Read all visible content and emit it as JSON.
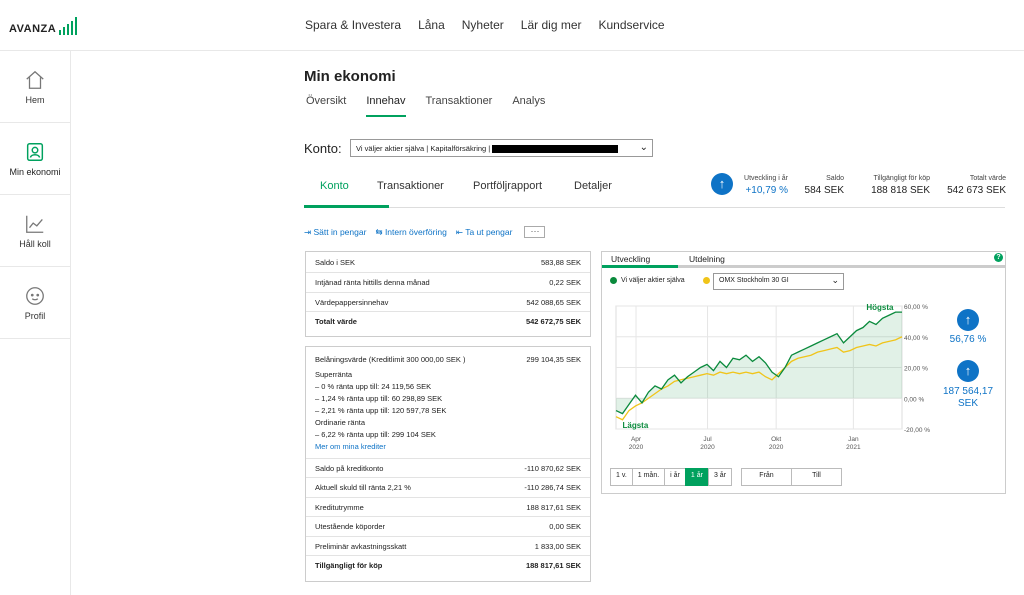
{
  "brand": {
    "name": "AVANZA",
    "accent": "#00a15e",
    "blue": "#0e73c6"
  },
  "topnav": [
    "Spara & Investera",
    "Låna",
    "Nyheter",
    "Lär dig mer",
    "Kundservice"
  ],
  "sidebar": [
    {
      "label": "Hem",
      "icon": "home-icon"
    },
    {
      "label": "Min ekonomi",
      "icon": "person-icon"
    },
    {
      "label": "Håll koll",
      "icon": "chart-icon"
    },
    {
      "label": "Profil",
      "icon": "face-icon"
    }
  ],
  "page": {
    "title": "Min ekonomi",
    "tabs": [
      "Översikt",
      "Innehav",
      "Transaktioner",
      "Analys"
    ],
    "active_tab": "Innehav"
  },
  "konto": {
    "label": "Konto:",
    "selected": "Vi väljer aktier själva | Kapitalförsäkring |"
  },
  "subtabs": [
    "Konto",
    "Transaktioner",
    "Portföljrapport",
    "Detaljer"
  ],
  "stats": {
    "utveckling_label": "Utveckling i år",
    "utveckling_value": "+10,79 %",
    "saldo_label": "Saldo",
    "saldo_value": "584 SEK",
    "tillg_label": "Tillgängligt för köp",
    "tillg_value": "188 818 SEK",
    "total_label": "Totalt värde",
    "total_value": "542 673 SEK"
  },
  "actions": [
    "Sätt in pengar",
    "Intern överföring",
    "Ta ut pengar",
    "···"
  ],
  "summary": [
    {
      "label": "Saldo i SEK",
      "value": "583,88 SEK"
    },
    {
      "label": "Intjänad ränta hittills denna månad",
      "value": "0,22 SEK"
    },
    {
      "label": "Värdepappersinnehav",
      "value": "542 088,65 SEK"
    },
    {
      "label": "Totalt värde",
      "value": "542 672,75 SEK"
    }
  ],
  "credit": {
    "belaning_label": "Belåningsvärde (Kreditlimit 300 000,00 SEK )",
    "belaning_value": "299 104,35 SEK",
    "lines": [
      "Superränta",
      "– 0 % ränta upp till: 24 119,56 SEK",
      "– 1,24 % ränta upp till: 60 298,89 SEK",
      "– 2,21 % ränta upp till: 120 597,78 SEK",
      "Ordinarie ränta",
      "– 6,22 % ränta upp till: 299 104 SEK"
    ],
    "link": "Mer om mina krediter",
    "rows": [
      {
        "label": "Saldo på kreditkonto",
        "value": "-110 870,62 SEK"
      },
      {
        "label": "Aktuell skuld till ränta 2,21 %",
        "value": "-110 286,74 SEK"
      },
      {
        "label": "Kreditutrymme",
        "value": "188 817,61 SEK"
      },
      {
        "label": "Utestående köporder",
        "value": "0,00 SEK"
      },
      {
        "label": "Preliminär avkastningsskatt",
        "value": "1 833,00 SEK"
      },
      {
        "label": "Tillgängligt för köp",
        "value": "188 817,61 SEK"
      }
    ]
  },
  "chart_tabs": [
    "Utveckling",
    "Utdelning"
  ],
  "chart_help": "?",
  "legend": {
    "series1": "Vi väljer aktier själva",
    "series2": "OMX Stockholm 30 GI"
  },
  "chart_data": {
    "type": "line",
    "x_ticks": [
      "Apr\n2020",
      "Jul\n2020",
      "Okt\n2020",
      "Jan\n2021"
    ],
    "y_ticks": [
      "60,00 %",
      "40,00 %",
      "20,00 %",
      "0,00 %",
      "-20,00 %"
    ],
    "ylim": [
      -20,
      60
    ],
    "high_label": "Högsta",
    "low_label": "Lägsta",
    "series": [
      {
        "name": "Vi väljer aktier själva",
        "color": "#0a8a3c",
        "values": [
          -8,
          -10,
          -4,
          2,
          -3,
          4,
          8,
          6,
          12,
          15,
          10,
          14,
          17,
          20,
          22,
          18,
          24,
          20,
          26,
          25,
          28,
          24,
          27,
          23,
          17,
          14,
          20,
          28,
          30,
          32,
          34,
          36,
          38,
          40,
          42,
          36,
          40,
          44,
          46,
          50,
          48,
          52,
          54,
          56,
          56
        ]
      },
      {
        "name": "OMX Stockholm 30 GI",
        "color": "#f0c419",
        "values": [
          -12,
          -14,
          -8,
          -5,
          -3,
          0,
          3,
          6,
          8,
          11,
          12,
          13,
          14,
          15,
          16,
          15,
          17,
          16,
          17,
          16,
          17,
          16,
          17,
          14,
          12,
          16,
          20,
          24,
          26,
          27,
          28,
          30,
          31,
          32,
          33,
          30,
          31,
          33,
          34,
          35,
          34,
          36,
          37,
          38,
          40
        ]
      }
    ]
  },
  "chart_side": {
    "pct": "56,76 %",
    "amount": "187 564,17",
    "unit": "SEK"
  },
  "periods": [
    "1 v.",
    "1 mån.",
    "i år",
    "1 år",
    "3 år"
  ],
  "active_period": "1 år",
  "range": [
    "Från",
    "Till"
  ]
}
